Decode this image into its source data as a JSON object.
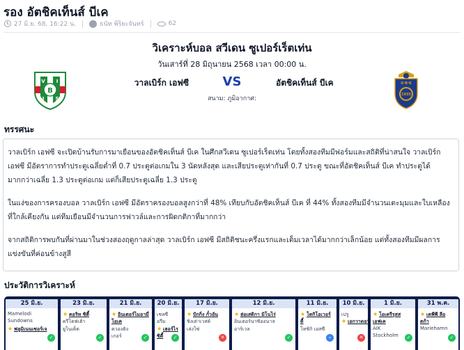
{
  "header": {
    "title": "รอง อัตชิคเท็นส์ บีเค",
    "date": "27 มิ.ย. 68, 16:22 น.",
    "author": "ธนัท พิริยะจันทร์",
    "views": "62"
  },
  "analysis": {
    "title": "วิเคราะห์บอล สวีเดน ซูเปอร์เร็ตเท่น",
    "date": "วันเสาร์ที่ 28 มิถุนายน 2568 เวลา 00:00 น.",
    "home_team": "วาลเบิร์ก เอฟซี",
    "vs": "VS",
    "away_team": "อัตชิคเท็นส์ บีเค",
    "venue": "สนาม: ภูมิอากาศ:"
  },
  "opinion": {
    "heading": "ทรรศนะ",
    "paragraphs": [
      "วาลเบิร์ก เอฟซี จะเปิดบ้านรับการมาเยือนของอัตชิคเท็นส์ บีเค ในศึกสวีเดน ซูเปอร์เร็ตเท่น โดยทั้งสองทีมมีฟอร์มและสถิติที่น่าสนใจ วาลเบิร์ก เอฟซี มีอัตราการทำประตูเฉลี่ยต่ำที่ 0.7 ประตูต่อเกมใน 3 นัดหลังสุด และเสียประตูเท่ากันที่ 0.7 ประตู ขณะที่อัตชิคเท็นส์ บีเค ทำประตูได้มากกว่าเฉลี่ย 1.3 ประตูต่อเกม แต่ก็เสียประตูเฉลี่ย 1.3 ประตู",
      "ในแง่ของการครองบอล วาลเบิร์ก เอฟซี มีอัตราครองบอลสูงกว่าที่ 48% เทียบกับอัตชิคเท็นส์ บีเค ที่ 44% ทั้งสองทีมมีจำนวนเตะมุมและใบเหลืองที่ใกล้เคียงกัน แต่ทีมเยือนมีจำนวนการฟาวล์และการผิดกติกาที่มากกว่า",
      "จากสถิติการพบกันที่ผ่านมาในช่วงสองฤดูกาลล่าสุด วาลเบิร์ก เอฟซี มีสถิติชนะครึ่งแรกและเต็มเวลาได้มากกว่าเล็กน้อย แต่ทั้งสองทีมมีผลการแข่งขันที่ค่อนข้างสูสี"
    ]
  },
  "history": {
    "heading": "ประวัติการวิเคราะห์",
    "columns": [
      {
        "date": "25 มิ.ย.",
        "lines": [
          {
            "text": "Mamelodi",
            "star": false,
            "bold": false
          },
          {
            "text": "Sundowns",
            "star": false,
            "bold": false
          },
          {
            "text": "ฟลูมิเนนเซอร์เจ",
            "star": true,
            "bold": true
          }
        ],
        "result": "W",
        "result_glyph": "✓"
      },
      {
        "date": "23 มิ.ย.",
        "lines": [
          {
            "text": "คอริท ซิตี้",
            "star": true,
            "bold": true
          },
          {
            "text": "ดรีโตฟเฮ้า",
            "star": false,
            "bold": false
          },
          {
            "text": "ยูไนเต็ด",
            "star": false,
            "bold": false
          }
        ],
        "result": "W",
        "result_glyph": "✓"
      },
      {
        "date": "21 มิ.ย.",
        "lines": [
          {
            "text": "อินเตอร์ไมอามี่",
            "star": true,
            "bold": true
          },
          {
            "text": "โอเค",
            "star": false,
            "bold": true
          },
          {
            "text": "ควองติง",
            "star": false,
            "bold": false
          },
          {
            "text": "เกอร์",
            "star": false,
            "bold": false
          }
        ],
        "result": "W",
        "result_glyph": "✓"
      },
      {
        "date": "20 มิ.ย.",
        "lines": [
          {
            "text": "เชลซี",
            "star": false,
            "bold": false
          },
          {
            "text": "อรีม",
            "star": false,
            "bold": false
          },
          {
            "text": "เฮอร์ไร",
            "star": true,
            "bold": true
          },
          {
            "text": "ซิตี้",
            "star": false,
            "bold": true
          }
        ],
        "result": "W",
        "result_glyph": "✓"
      },
      {
        "date": "17 มิ.ย.",
        "lines": [
          {
            "text": "ปักกิ่ง กั๋วอัน",
            "star": true,
            "bold": true
          },
          {
            "text": "ชิงเต่าเวสต์",
            "star": false,
            "bold": false
          },
          {
            "text": "เล่งไซ่",
            "star": false,
            "bold": false
          }
        ],
        "result": "L",
        "result_glyph": "✕"
      },
      {
        "date": "12 มิ.ย.",
        "lines": [
          {
            "text": "ฮ่อเสดิกา มิโนไร่",
            "star": true,
            "bold": true
          },
          {
            "text": "อินเตอร์นาซิออนาล",
            "star": false,
            "bold": false
          },
          {
            "text": "อาร์เวล",
            "star": false,
            "bold": false
          }
        ],
        "result": "W",
        "result_glyph": "✓"
      },
      {
        "date": "11 มิ.ย.",
        "lines": [
          {
            "text": "โตกิโอเวอร์",
            "star": true,
            "bold": true
          },
          {
            "text": "ดี้",
            "star": false,
            "bold": true
          },
          {
            "text": "โทชิกิ เอสซี",
            "star": false,
            "bold": false
          }
        ],
        "result": "D",
        "result_glyph": "–"
      },
      {
        "date": "10 มิ.ย.",
        "lines": [
          {
            "text": "เปรู",
            "star": false,
            "bold": false
          },
          {
            "text": "เอกวาดอร์",
            "star": true,
            "bold": true
          }
        ],
        "result": "L",
        "result_glyph": "✕"
      },
      {
        "date": "1 มิ.ย.",
        "lines": [
          {
            "text": "โอเครีรุสส",
            "star": true,
            "bold": true
          },
          {
            "text": "เอฟเค",
            "star": false,
            "bold": true
          },
          {
            "text": "AIK",
            "star": false,
            "bold": false
          },
          {
            "text": "Stockholm",
            "star": false,
            "bold": false
          }
        ],
        "result": "W",
        "result_glyph": "✓"
      },
      {
        "date": "31 พ.ค.",
        "lines": [
          {
            "text": "เคพีพี ลีอ",
            "star": true,
            "bold": true
          },
          {
            "text": "ตก้า",
            "star": false,
            "bold": true
          },
          {
            "text": "Mariehamn",
            "star": false,
            "bold": false
          }
        ],
        "result": "W",
        "result_glyph": "✓"
      }
    ]
  },
  "colors": {
    "navy": "#0d1d4a",
    "win": "#22c55e",
    "loss": "#ef4444",
    "draw": "#3b82f6",
    "star": "#eab308",
    "home_green": "#1f8a3a",
    "home_red": "#d31f2f",
    "away_blue": "#1e3a8a",
    "away_gold": "#d4a017"
  },
  "icons": [
    "clock-icon",
    "user-icon",
    "eye-icon",
    "star-icon",
    "result-icon"
  ]
}
